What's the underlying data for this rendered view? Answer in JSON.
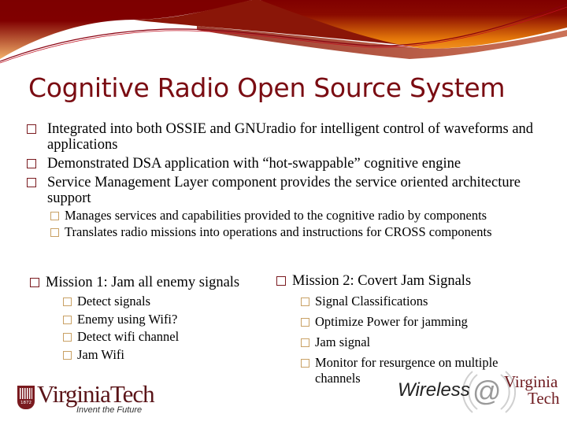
{
  "slide": {
    "title": "Cognitive Radio Open Source System",
    "bullets": [
      {
        "text": "Integrated into both OSSIE and GNUradio for intelligent control of waveforms and applications"
      },
      {
        "text": "Demonstrated DSA application with “hot-swappable” cognitive engine"
      },
      {
        "text": "Service Management Layer component provides the service oriented architecture support"
      }
    ],
    "sub_bullets": [
      {
        "text": "Manages services and capabilities provided to the cognitive radio by components"
      },
      {
        "text": "Translates radio missions into operations and instructions for CROSS components"
      }
    ],
    "mission1": {
      "heading": "Mission 1: Jam all enemy signals",
      "items": [
        "Detect signals",
        "Enemy using Wifi?",
        "Detect wifi channel",
        "Jam Wifi"
      ]
    },
    "mission2": {
      "heading": "Mission 2: Covert Jam Signals",
      "items": [
        "Signal Classifications",
        "Optimize Power for jamming",
        "Jam signal",
        "Monitor for resurgence on multiple channels"
      ]
    }
  },
  "logos": {
    "virginia_tech": {
      "name": "VirginiaTech",
      "tagline": "Invent the Future",
      "year": "1872"
    },
    "wireless_vt": {
      "wireless": "Wireless",
      "at": "@",
      "virginia": "Virginia",
      "tech": "Tech"
    }
  },
  "colors": {
    "title": "#7a0c12",
    "bullet_primary": "#7a1a1f",
    "bullet_secondary": "#c9a165",
    "header_dark": "#7d0000",
    "header_orange": "#e8840c"
  },
  "icons": {
    "bullet": "square-bullet-icon",
    "header": "wave-banner-icon"
  }
}
